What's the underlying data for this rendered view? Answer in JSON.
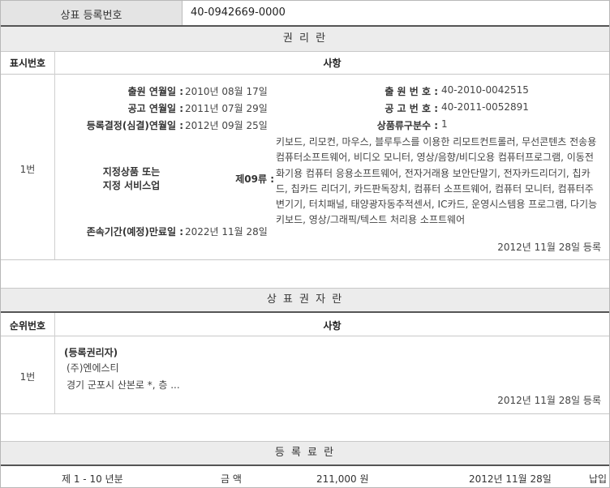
{
  "header": {
    "label": "상표 등록번호",
    "value": "40-0942669-0000"
  },
  "rights": {
    "title": "권 리 란",
    "col_num": "표시번호",
    "col_item": "사항",
    "row_num": "1번",
    "app_date_label": "출원 연월일 :",
    "app_date": "2010년 08월 17일",
    "app_no_label": "출 원 번 호 :",
    "app_no": "40-2010-0042515",
    "pub_date_label": "공고 연월일 :",
    "pub_date": "2011년 07월 29일",
    "pub_no_label": "공 고 번 호 :",
    "pub_no": "40-2011-0052891",
    "decision_label": "등록결정(심결)연월일 :",
    "decision_date": "2012년 09월 25일",
    "class_count_label": "상품류구분수 :",
    "class_count": "1",
    "goods_label_1": "지정상품 또는",
    "goods_label_2": "지정 서비스업",
    "goods_class": "제09류 :",
    "goods_text": "키보드, 리모컨, 마우스, 블루투스를 이용한 리모트컨트롤러, 무선콘텐츠 전송용 컴퓨터소프트웨어, 비디오 모니터, 영상/음향/비디오용 컴퓨터프로그램, 이동전화기용 컴퓨터 응용소프트웨어, 전자거래용 보안단말기, 전자카드리더기, 칩카드, 칩카드 리더기, 카드판독장치, 컴퓨터 소프트웨어, 컴퓨터 모니터, 컴퓨터주변기기, 터치패널, 태양광자동추적센서, IC카드, 운영시스템용 프로그램, 다기능 키보드, 영상/그래픽/텍스트 처리용 소프트웨어",
    "expiry_label": "존속기간(예정)만료일 :",
    "expiry_date": "2022년 11월 28일",
    "registered_note": "2012년 11월 28일 등록"
  },
  "owners": {
    "title": "상 표 권 자 란",
    "col_num": "순위번호",
    "col_item": "사항",
    "row_num": "1번",
    "type": "(등록권리자)",
    "name": "(주)엔에스티",
    "address": "경기 군포시 산본로 *, 층 ...",
    "registered_note": "2012년 11월 28일 등록"
  },
  "fees": {
    "title": "등 록 료 란",
    "period": "제 1 - 10 년분",
    "amount_label": "금 액",
    "amount": "211,000 원",
    "date": "2012년 11월 28일",
    "status": "납입"
  }
}
